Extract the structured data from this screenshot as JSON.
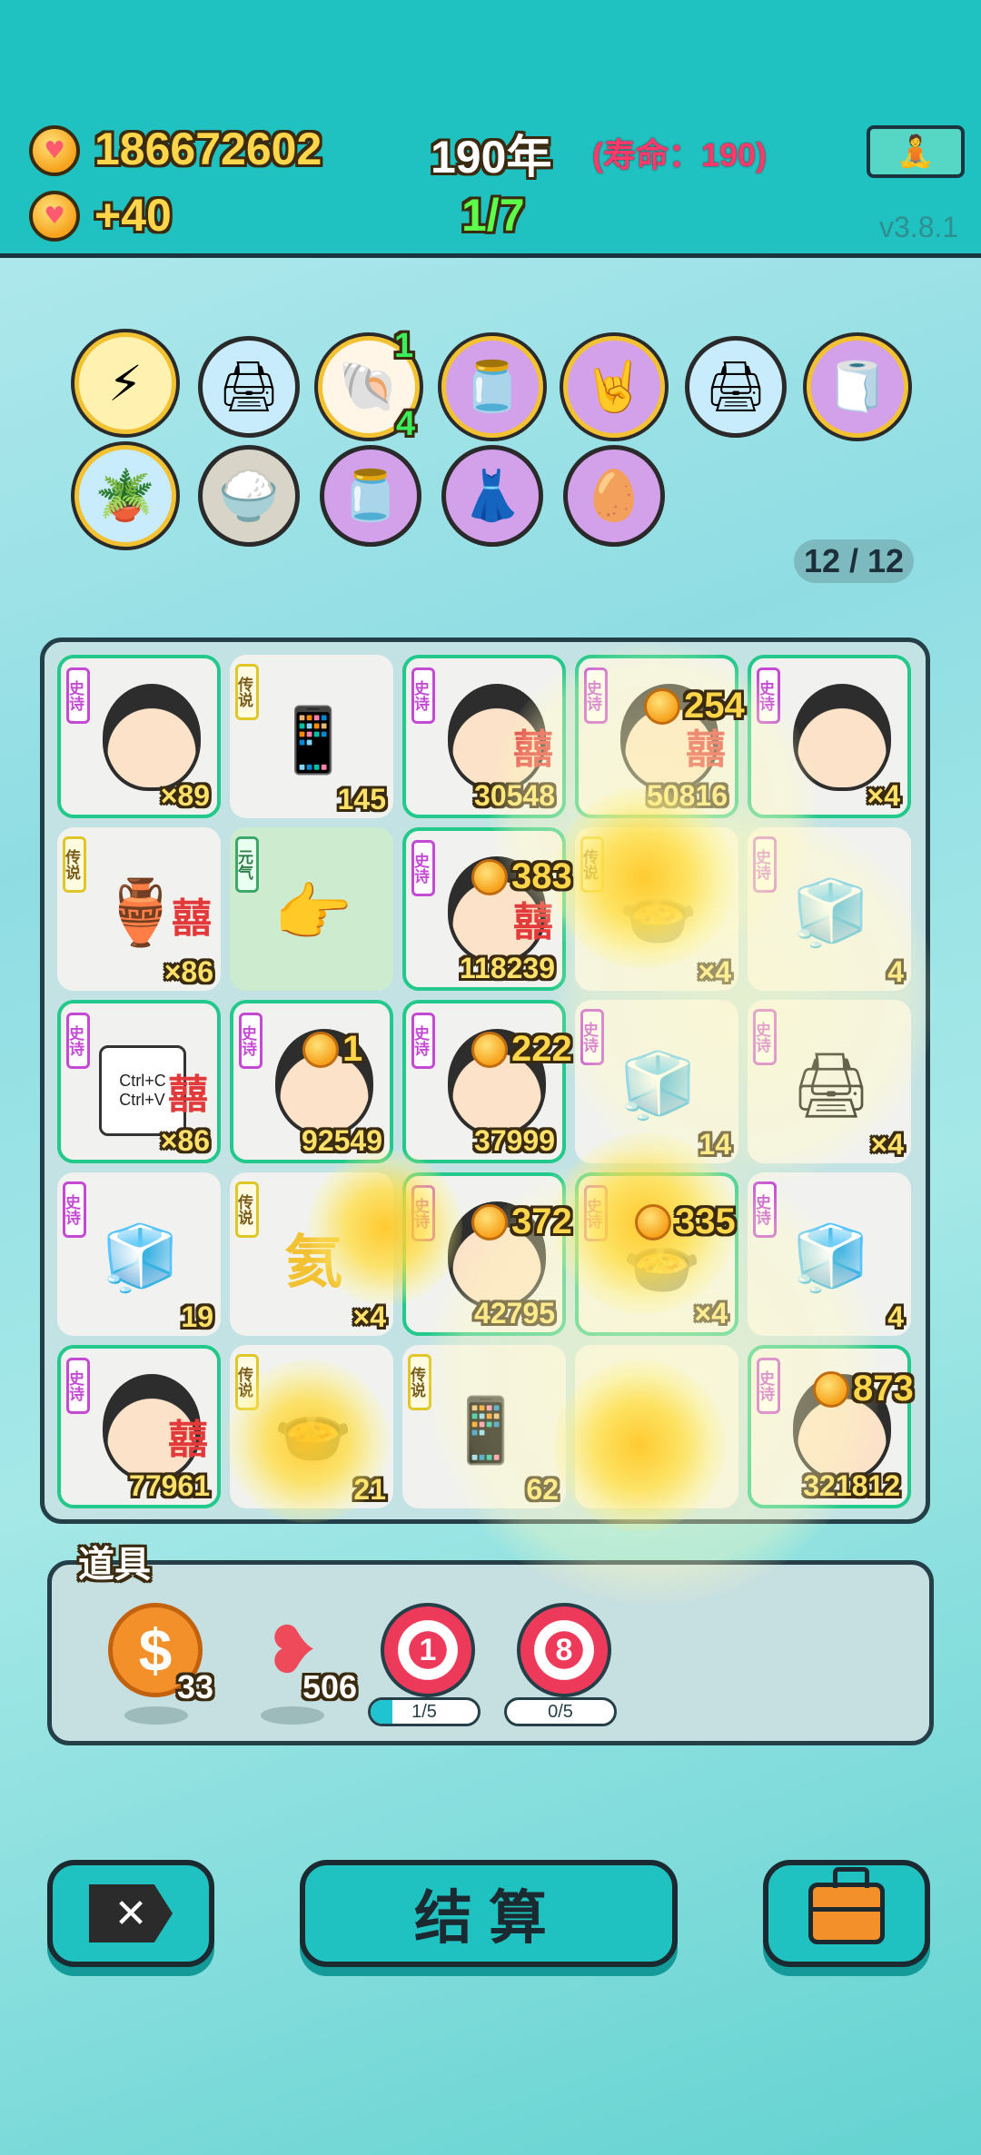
{
  "header": {
    "money": "186672602",
    "income": "+40",
    "year": "190年",
    "lifespan": "(寿命：190)",
    "stage": "1/7",
    "version": "v3.8.1",
    "meditate_icon": "meditate-icon"
  },
  "relics": {
    "items": [
      {
        "icon": "lightning-icon",
        "glyph": "⚡"
      },
      {
        "icon": "printer-warning-icon",
        "glyph": "🖨"
      },
      {
        "icon": "shell-icon",
        "glyph": "🐚",
        "top": "1",
        "bottom": "4"
      },
      {
        "icon": "jar-icon",
        "glyph": "🫙"
      },
      {
        "icon": "rock-hand-icon",
        "glyph": "🤘"
      },
      {
        "icon": "printer-warning-icon",
        "glyph": "🖨"
      },
      {
        "icon": "tissue-box-icon",
        "glyph": "🧻"
      },
      {
        "icon": "potted-flower-icon",
        "glyph": "🪴"
      },
      {
        "icon": "rice-bowl-icon",
        "glyph": "🍚"
      },
      {
        "icon": "jar-icon",
        "glyph": "🫙"
      },
      {
        "icon": "skirt-icon",
        "glyph": "👗"
      },
      {
        "icon": "egg-icon",
        "glyph": "🥚"
      }
    ],
    "counter": "12 / 12"
  },
  "board": {
    "tiles": [
      {
        "tag": "史诗",
        "num": "×89"
      },
      {
        "tag": "传说",
        "num": "145"
      },
      {
        "tag": "史诗",
        "num": "30548"
      },
      {
        "tag": "史诗",
        "num": "50816"
      },
      {
        "tag": "史诗",
        "num": "×4"
      },
      {
        "tag": "传说",
        "num": "×86"
      },
      {
        "tag": "元气",
        "num": ""
      },
      {
        "tag": "史诗",
        "num": "118239"
      },
      {
        "tag": "传说",
        "num": "×4"
      },
      {
        "tag": "史诗",
        "num": "4"
      },
      {
        "tag": "史诗",
        "num": "×86"
      },
      {
        "tag": "史诗",
        "num": "92549"
      },
      {
        "tag": "史诗",
        "num": "37999"
      },
      {
        "tag": "史诗",
        "num": "14"
      },
      {
        "tag": "史诗",
        "num": "×4"
      },
      {
        "tag": "史诗",
        "num": "19"
      },
      {
        "tag": "传说",
        "num": "×4"
      },
      {
        "tag": "史诗",
        "num": "42795"
      },
      {
        "tag": "史诗",
        "num": "×4"
      },
      {
        "tag": "史诗",
        "num": "4"
      },
      {
        "tag": "史诗",
        "num": "77961"
      },
      {
        "tag": "传说",
        "num": "21"
      },
      {
        "tag": "传说",
        "num": "62"
      },
      {
        "tag": "",
        "num": ""
      },
      {
        "tag": "史诗",
        "num": "321812"
      }
    ],
    "bonuses": [
      "254",
      "383",
      "1",
      "222",
      "372",
      "335",
      "873"
    ],
    "element_char": "氦",
    "xi_char": "囍",
    "copy_text": "Ctrl+C\nCtrl+V"
  },
  "tools": {
    "title": "道具",
    "items": [
      {
        "icon": "dollar-coin-icon",
        "count": "33"
      },
      {
        "icon": "liver-icon",
        "count": "506"
      },
      {
        "icon": "target-1-icon",
        "label": "1",
        "progress": "1/5",
        "fraction": 0.2
      },
      {
        "icon": "target-8-icon",
        "label": "8",
        "progress": "0/5",
        "fraction": 0.0
      }
    ]
  },
  "buttons": {
    "settle": "结算",
    "close_icon": "close-icon",
    "bag_icon": "briefcase-icon"
  },
  "colors": {
    "header": "#1fc2c0",
    "gold": "#ffd64a",
    "life": "#ff3a6a",
    "stage": "#5dff4a",
    "epic_tag": "#c44ad4",
    "legend_tag": "#e0c728"
  }
}
